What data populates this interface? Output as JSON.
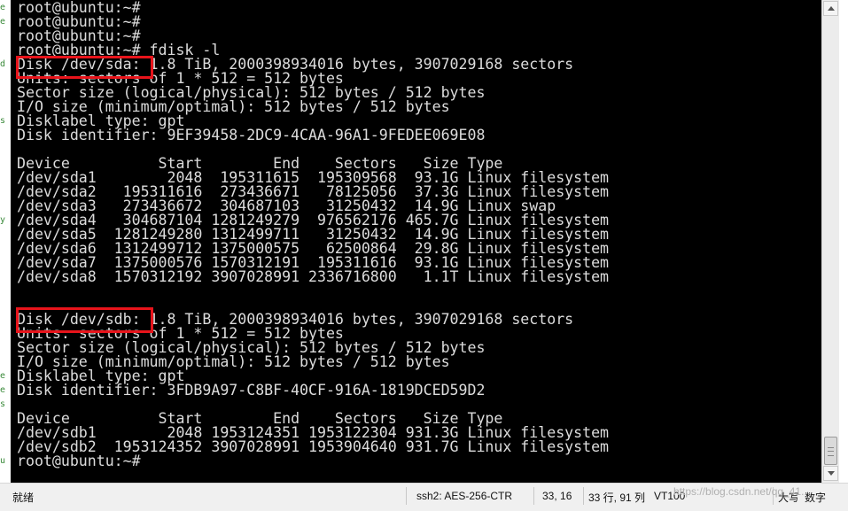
{
  "terminal": {
    "lines": [
      "root@ubuntu:~#",
      "root@ubuntu:~#",
      "root@ubuntu:~#",
      "root@ubuntu:~# fdisk -l",
      "Disk /dev/sda: 1.8 TiB, 2000398934016 bytes, 3907029168 sectors",
      "Units: sectors of 1 * 512 = 512 bytes",
      "Sector size (logical/physical): 512 bytes / 512 bytes",
      "I/O size (minimum/optimal): 512 bytes / 512 bytes",
      "Disklabel type: gpt",
      "Disk identifier: 9EF39458-2DC9-4CAA-96A1-9FEDEE069E08",
      "",
      "Device          Start        End    Sectors   Size Type",
      "/dev/sda1        2048  195311615  195309568  93.1G Linux filesystem",
      "/dev/sda2   195311616  273436671   78125056  37.3G Linux filesystem",
      "/dev/sda3   273436672  304687103   31250432  14.9G Linux swap",
      "/dev/sda4   304687104 1281249279  976562176 465.7G Linux filesystem",
      "/dev/sda5  1281249280 1312499711   31250432  14.9G Linux filesystem",
      "/dev/sda6  1312499712 1375000575   62500864  29.8G Linux filesystem",
      "/dev/sda7  1375000576 1570312191  195311616  93.1G Linux filesystem",
      "/dev/sda8  1570312192 3907028991 2336716800   1.1T Linux filesystem",
      "",
      "",
      "Disk /dev/sdb: 1.8 TiB, 2000398934016 bytes, 3907029168 sectors",
      "Units: sectors of 1 * 512 = 512 bytes",
      "Sector size (logical/physical): 512 bytes / 512 bytes",
      "I/O size (minimum/optimal): 512 bytes / 512 bytes",
      "Disklabel type: gpt",
      "Disk identifier: 3FDB9A97-C8BF-40CF-916A-1819DCED59D2",
      "",
      "Device          Start        End    Sectors   Size Type",
      "/dev/sdb1        2048 1953124351 1953122304 931.3G Linux filesystem",
      "/dev/sdb2  1953124352 3907028991 1953904640 931.7G Linux filesystem",
      "root@ubuntu:~#"
    ],
    "highlights": [
      "Disk /dev/sda:",
      "Disk /dev/sdb:"
    ],
    "colors": {
      "background": "#000000",
      "foreground": "#dcdcdc",
      "highlight_border": "#e8141b"
    }
  },
  "statusbar": {
    "ready": "就绪",
    "cipher": "ssh2: AES-256-CTR",
    "cursor_pos": "33,  16",
    "row_col": "33 行, 91 列",
    "terminal_type": "VT100",
    "caps": "大写",
    "num": "数字"
  },
  "watermark": "https://blog.csdn.net/qq_41..."
}
